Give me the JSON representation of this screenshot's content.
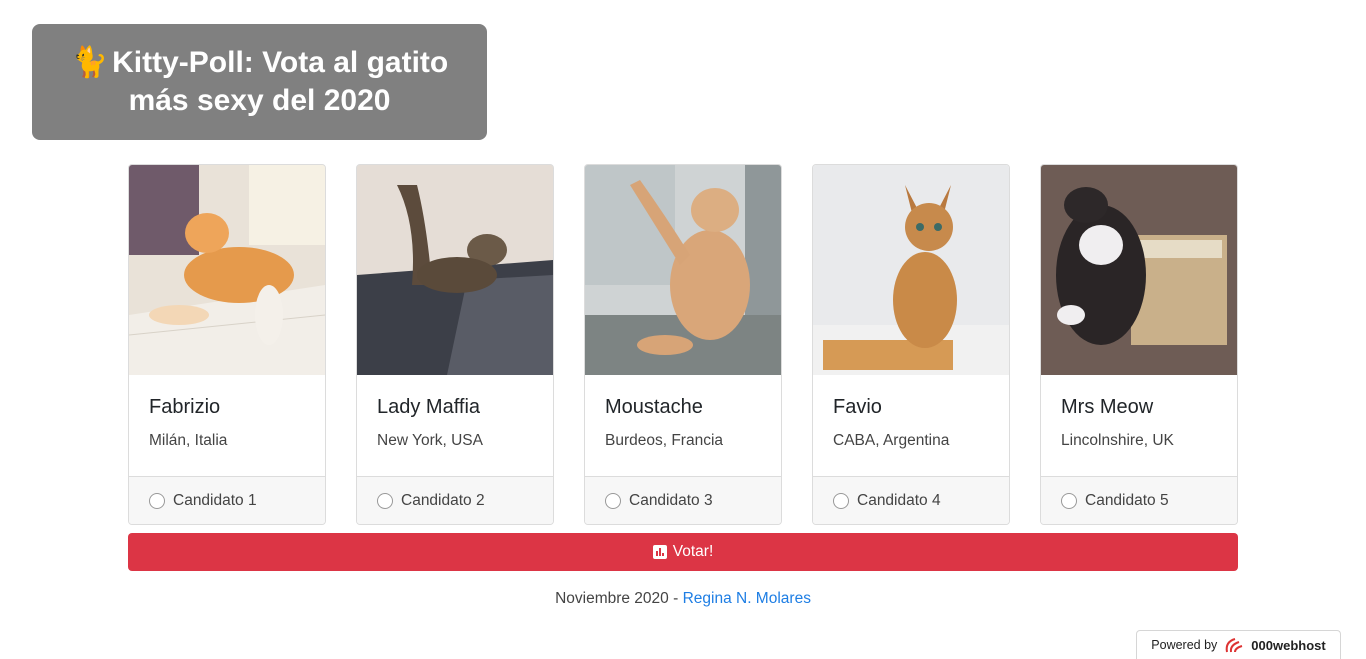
{
  "header": {
    "icon": "cat-icon",
    "title": "Kitty-Poll: Vota al gatito más sexy del 2020"
  },
  "candidates": [
    {
      "name": "Fabrizio",
      "location": "Milán, Italia",
      "option": "Candidato 1"
    },
    {
      "name": "Lady Maffia",
      "location": "New York, USA",
      "option": "Candidato 2"
    },
    {
      "name": "Moustache",
      "location": "Burdeos, Francia",
      "option": "Candidato 3"
    },
    {
      "name": "Favio",
      "location": "CABA, Argentina",
      "option": "Candidato 4"
    },
    {
      "name": "Mrs Meow",
      "location": "Lincolnshire, UK",
      "option": "Candidato 5"
    }
  ],
  "vote_button": {
    "icon": "bar-chart-icon",
    "label": "Votar!",
    "color": "#dc3545"
  },
  "footer": {
    "date": "Noviembre 2020 - ",
    "author": "Regina N. Molares",
    "link_color": "#1e7ee4"
  },
  "powered": {
    "prefix": "Powered by",
    "brand": "000webhost"
  }
}
